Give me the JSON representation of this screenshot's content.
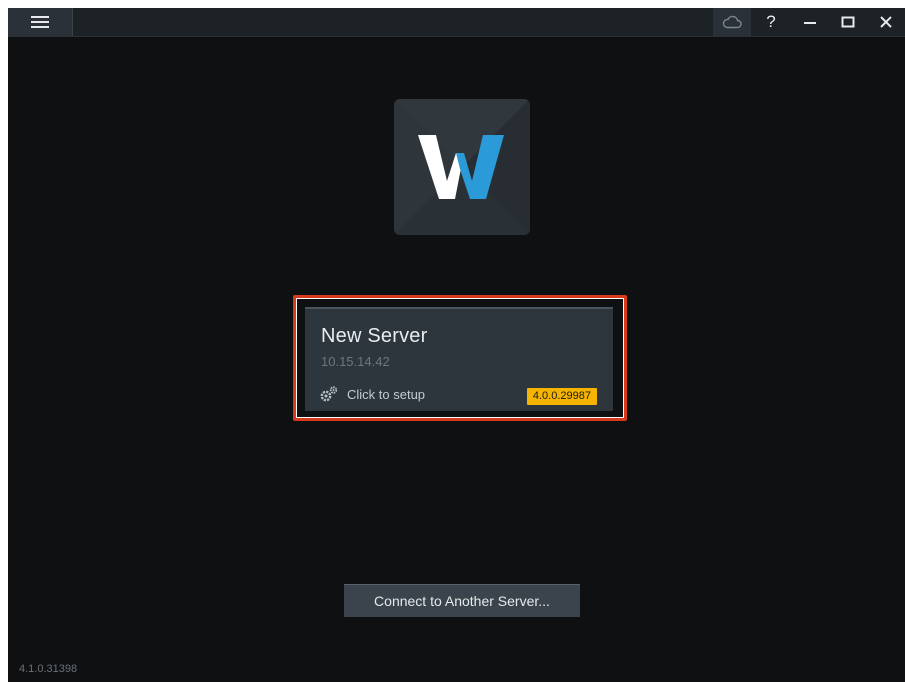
{
  "titlebar": {
    "menu_icon": "hamburger-menu-icon",
    "cloud_icon": "cloud-icon",
    "help_label": "?",
    "minimize_label": "–",
    "close_label": "✕"
  },
  "logo": {
    "letter": "W",
    "colors": {
      "left": "#ffffff",
      "right": "#2b9ad8",
      "tile": "#2c3338"
    }
  },
  "server_card": {
    "name": "New Server",
    "ip": "10.15.14.42",
    "setup_icon": "gears-icon",
    "setup_label": "Click to setup",
    "version": "4.0.0.29987",
    "highlight_color": "#d63a1c",
    "badge_color": "#f5b400"
  },
  "connect_button": {
    "label": "Connect to Another Server..."
  },
  "footer": {
    "app_version": "4.1.0.31398"
  }
}
